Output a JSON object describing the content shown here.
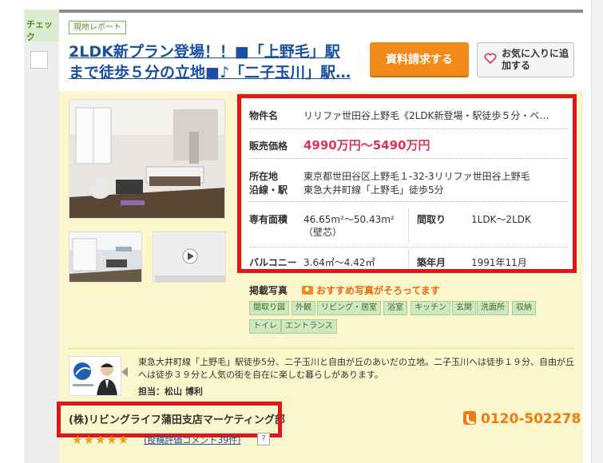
{
  "check": {
    "label": "チェック"
  },
  "listing": {
    "report_badge": "現地レポート",
    "title": "2LDK新プラン登場！！■「上野毛」駅まで徒歩５分の立地■♪「二子玉川」駅…",
    "request_button": "資料請求する",
    "favorite_button": "お気に入りに追加する",
    "details": {
      "name_label": "物件名",
      "name_value": "リリファ世田谷上野毛《2LDK新登場・駅徒歩５分・ベ…",
      "price_label": "販売価格",
      "price_value": "4990万円～5490万円",
      "address_label": "所在地",
      "address_value": "東京都世田谷区上野毛１-32-3リリファ世田谷上野毛",
      "line_label": "沿線・駅",
      "line_value": "東急大井町線「上野毛」徒歩5分",
      "area_label": "専有面積",
      "area_value": "46.65m²～50.43m²",
      "area_note": "（壁芯）",
      "layout_label": "間取り",
      "layout_value": "1LDK～2LDK",
      "balcony_label": "バルコニー",
      "balcony_value": "3.64㎡～4.42㎡",
      "built_label": "築年月",
      "built_value": "1991年11月"
    },
    "photos": {
      "label": "掲載写真",
      "note": "おすすめ写真がそろってます",
      "tags": [
        "間取り図",
        "外観",
        "リビング・居室",
        "浴室",
        "キッチン",
        "玄関",
        "洗面所",
        "収納",
        "トイレ",
        "エントランス"
      ]
    },
    "description": "東急大井町線「上野毛」駅徒歩5分、二子玉川と自由が丘のあいだの立地。二子玉川へは徒歩１９分、自由が丘へは徒歩３９分と人気の街を自在に楽しむ暮らしがあります。",
    "agent": "担当：松山 博利",
    "company": "(株)リビングライフ蒲田支店マーケティング部",
    "stars": "★★★★★",
    "review_link": "(投稿評価コメント39件)",
    "help": "?",
    "phone": "0120-502278"
  },
  "colors": {
    "accent_orange": "#f28a1a",
    "price_red": "#e0334f",
    "link_blue": "#1a4fa3",
    "highlight_red": "#e0161d"
  }
}
